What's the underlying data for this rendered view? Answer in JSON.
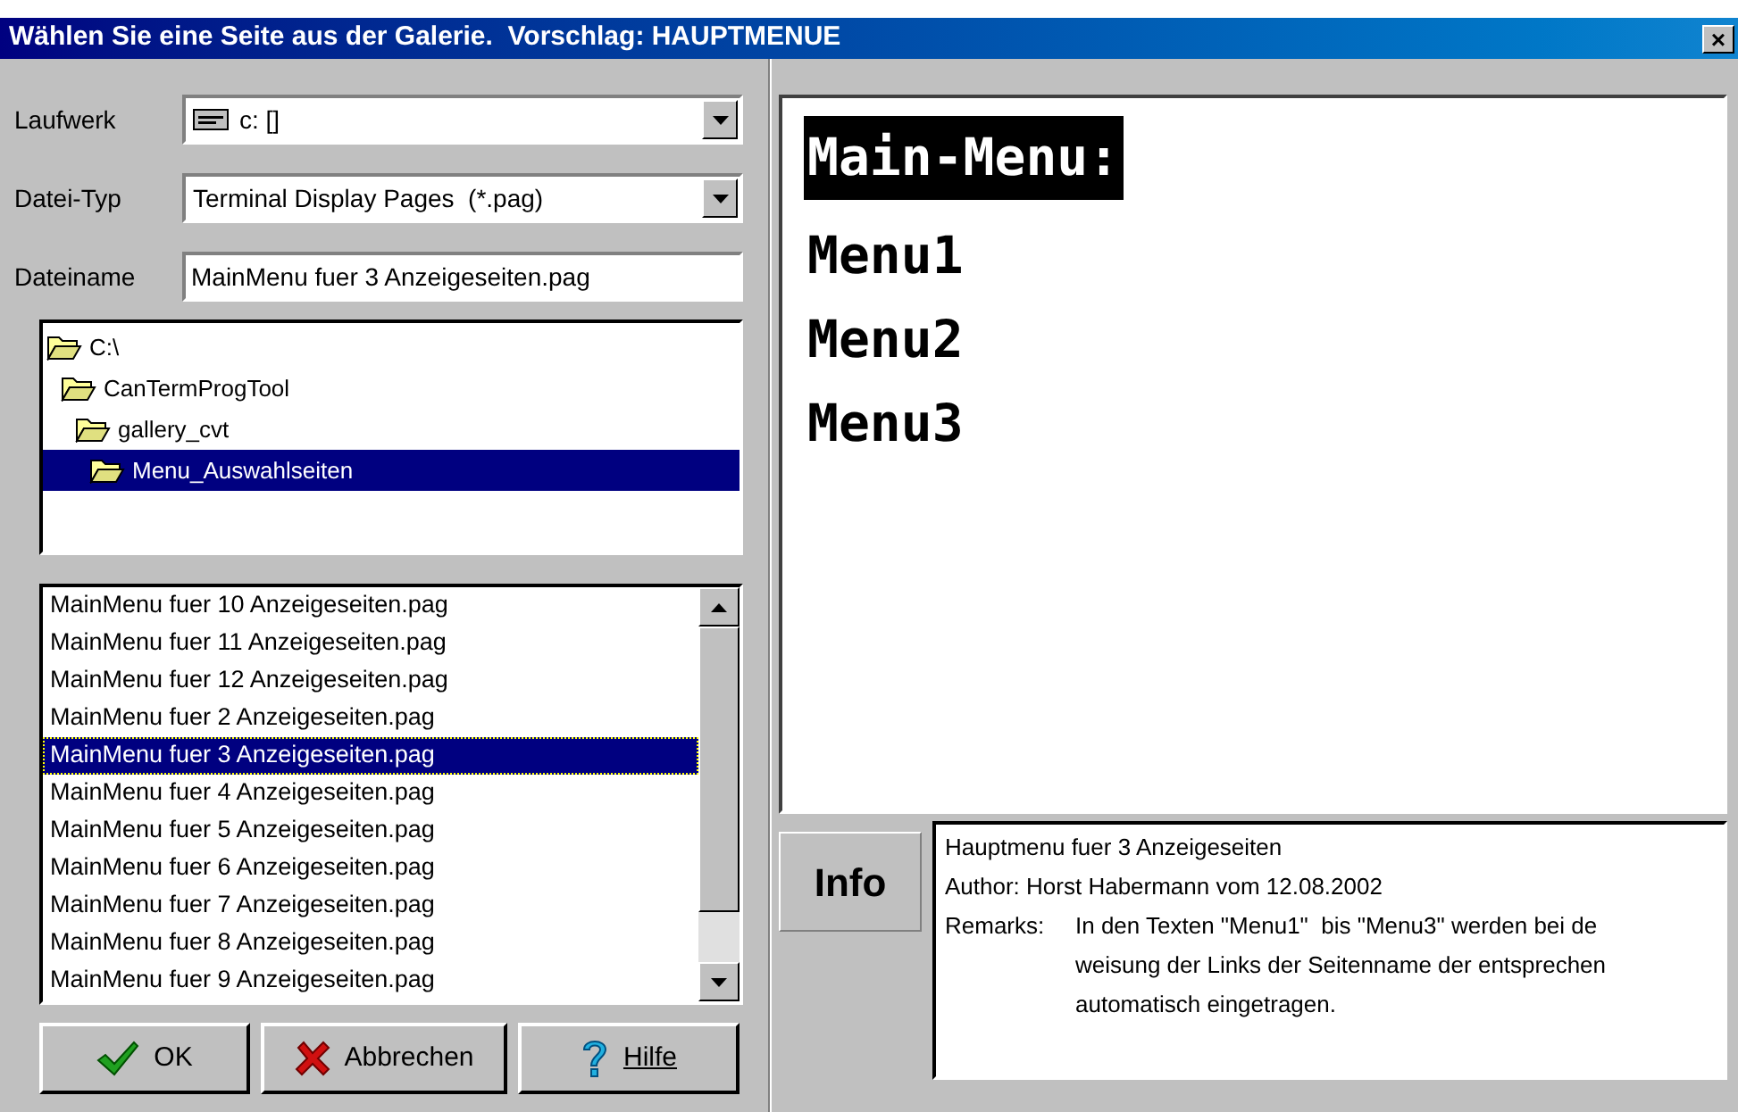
{
  "window": {
    "title": "Wählen Sie eine Seite aus der Galerie.  Vorschlag: HAUPTMENUE",
    "close": "×"
  },
  "drive": {
    "label": "Laufwerk",
    "value": "c: []"
  },
  "file_type": {
    "label": "Datei-Typ",
    "value": "Terminal Display Pages  (*.pag)"
  },
  "file_name": {
    "label": "Dateiname",
    "value": "MainMenu fuer 3 Anzeigeseiten.pag"
  },
  "folders": [
    {
      "label": "C:\\",
      "selected": false,
      "children": [
        {
          "label": "CanTermProgTool",
          "selected": false,
          "children": [
            {
              "label": "gallery_cvt",
              "selected": false,
              "children": [
                {
                  "label": "Menu_Auswahlseiten",
                  "selected": true
                }
              ]
            }
          ]
        }
      ]
    }
  ],
  "files": [
    {
      "label": "MainMenu fuer 10 Anzeigeseiten.pag",
      "selected": false
    },
    {
      "label": "MainMenu fuer 11 Anzeigeseiten.pag",
      "selected": false
    },
    {
      "label": "MainMenu fuer 12 Anzeigeseiten.pag",
      "selected": false
    },
    {
      "label": "MainMenu fuer 2 Anzeigeseiten.pag",
      "selected": false
    },
    {
      "label": "MainMenu fuer 3 Anzeigeseiten.pag",
      "selected": true
    },
    {
      "label": "MainMenu fuer 4 Anzeigeseiten.pag",
      "selected": false
    },
    {
      "label": "MainMenu fuer 5 Anzeigeseiten.pag",
      "selected": false
    },
    {
      "label": "MainMenu fuer 6 Anzeigeseiten.pag",
      "selected": false
    },
    {
      "label": "MainMenu fuer 7 Anzeigeseiten.pag",
      "selected": false
    },
    {
      "label": "MainMenu fuer 8 Anzeigeseiten.pag",
      "selected": false
    },
    {
      "label": "MainMenu fuer 9 Anzeigeseiten.pag",
      "selected": false
    }
  ],
  "buttons": [
    {
      "kind": "ok",
      "label": "OK"
    },
    {
      "kind": "cancel",
      "label": "Abbrechen"
    },
    {
      "kind": "help",
      "label": "Hilfe"
    }
  ],
  "preview": {
    "lines": [
      {
        "text": "Main-Menu:",
        "inverted": true
      },
      {
        "text": "Menu1",
        "inverted": false
      },
      {
        "text": "Menu2",
        "inverted": false
      },
      {
        "text": "Menu3",
        "inverted": false
      }
    ]
  },
  "info": {
    "button": "Info",
    "title": "Hauptmenu fuer 3 Anzeigeseiten",
    "author": "Author: Horst Habermann vom 12.08.2002",
    "remarks_label": "Remarks:",
    "remarks": [
      "In den Texten \"Menu1\"  bis \"Menu3\" werden bei de",
      "weisung der Links der Seitenname der entsprechen",
      "automatisch eingetragen."
    ]
  }
}
